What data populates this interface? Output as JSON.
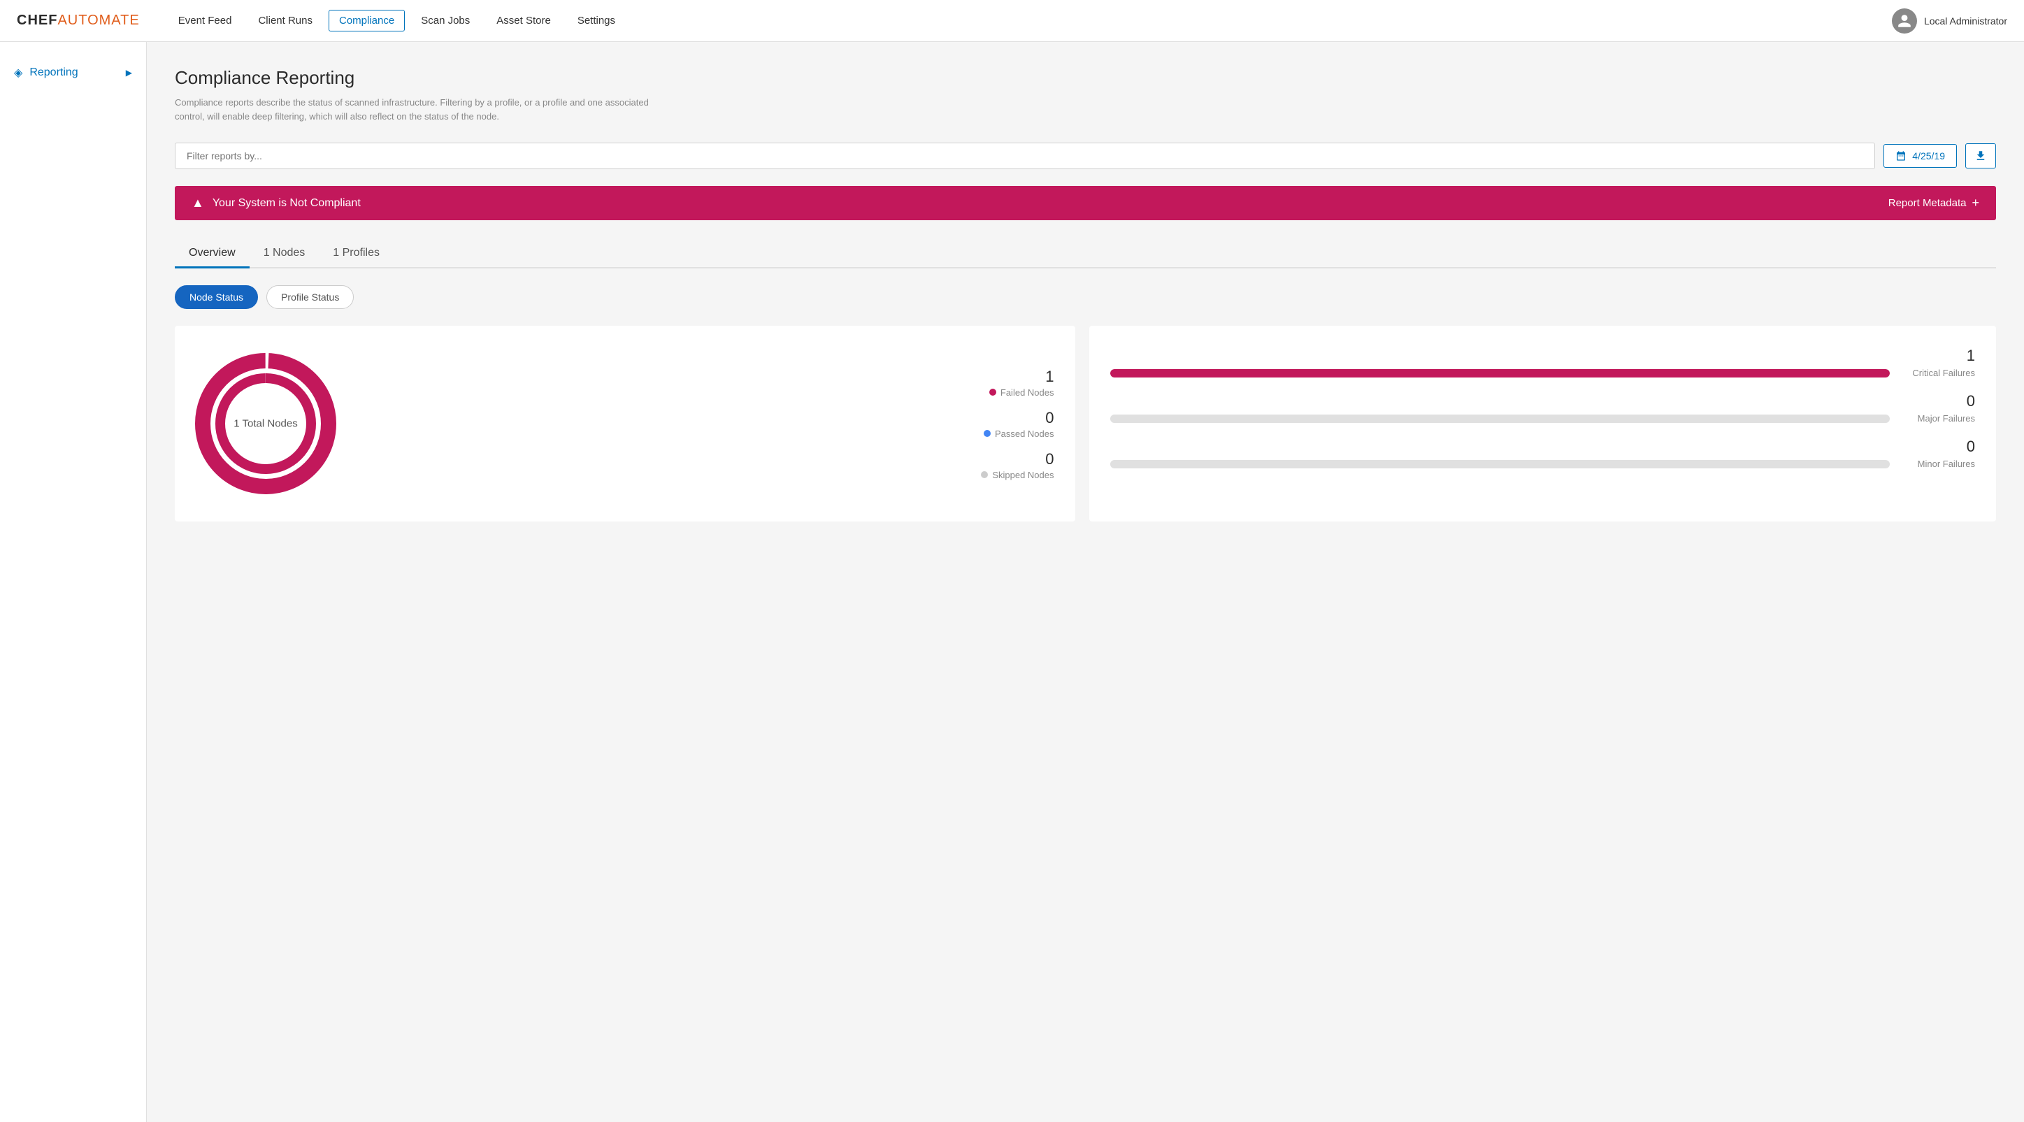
{
  "app": {
    "logo_chef": "CHEF",
    "logo_automate": "AUTOMATE"
  },
  "nav": {
    "links": [
      {
        "label": "Event Feed",
        "active": false
      },
      {
        "label": "Client Runs",
        "active": false
      },
      {
        "label": "Compliance",
        "active": true
      },
      {
        "label": "Scan Jobs",
        "active": false
      },
      {
        "label": "Asset Store",
        "active": false
      },
      {
        "label": "Settings",
        "active": false
      }
    ],
    "user_name": "Local Administrator"
  },
  "sidebar": {
    "item_label": "Reporting",
    "item_icon": "◈"
  },
  "page": {
    "title": "Compliance Reporting",
    "description": "Compliance reports describe the status of scanned infrastructure. Filtering by a profile, or a profile and one associated control, will enable deep filtering, which will also reflect on the status of the node.",
    "filter_placeholder": "Filter reports by...",
    "date_label": "4/25/19",
    "download_icon": "⬇"
  },
  "banner": {
    "icon": "▲",
    "message": "Your System is Not Compliant",
    "action_label": "Report Metadata",
    "action_icon": "+"
  },
  "tabs": [
    {
      "label": "Overview",
      "active": true
    },
    {
      "label": "1 Nodes",
      "active": false
    },
    {
      "label": "1 Profiles",
      "active": false
    }
  ],
  "status_toggle": {
    "node_status": "Node Status",
    "profile_status": "Profile Status"
  },
  "donut_chart": {
    "center_label": "1 Total Nodes",
    "total": 1,
    "failed": 1,
    "passed": 0,
    "skipped": 0,
    "legend": [
      {
        "count": "1",
        "label": "Failed Nodes",
        "color": "#c2185b"
      },
      {
        "count": "0",
        "label": "Passed Nodes",
        "color": "#4285f4"
      },
      {
        "count": "0",
        "label": "Skipped Nodes",
        "color": "#ccc"
      }
    ]
  },
  "bar_chart": {
    "bars": [
      {
        "count": "1",
        "label": "Critical Failures",
        "fill_pct": 100,
        "color": "#c2185b"
      },
      {
        "count": "0",
        "label": "Major Failures",
        "fill_pct": 0,
        "color": "#e0e0e0"
      },
      {
        "count": "0",
        "label": "Minor Failures",
        "fill_pct": 0,
        "color": "#e0e0e0"
      }
    ]
  },
  "colors": {
    "accent_blue": "#0073bb",
    "accent_pink": "#c2185b",
    "failed_dot": "#c2185b",
    "passed_dot": "#4285f4",
    "skipped_dot": "#cccccc"
  }
}
